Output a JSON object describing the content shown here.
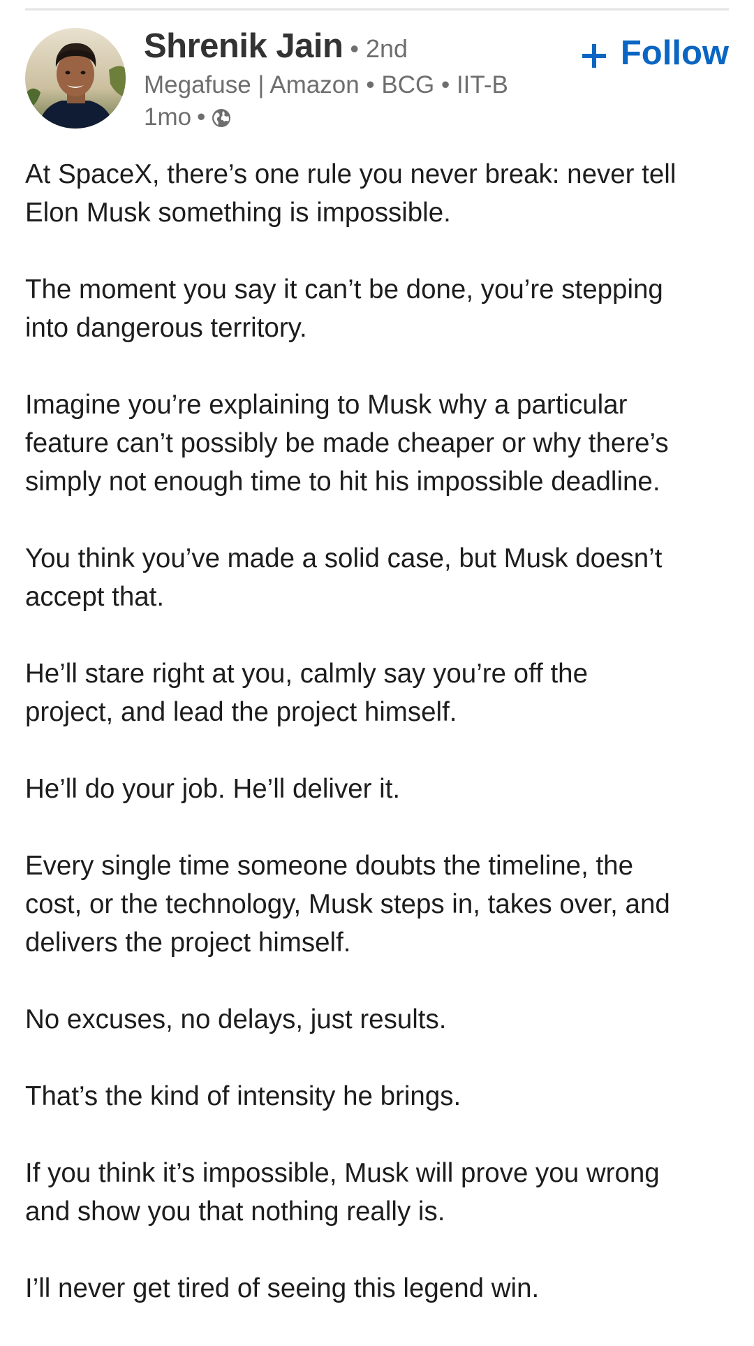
{
  "post": {
    "author": {
      "name": "Shrenik Jain",
      "degree": "• 2nd",
      "headline": "Megafuse | Amazon • BCG • IIT-B",
      "time": "1mo",
      "time_sep": "•",
      "visibility_icon": "globe-icon",
      "avatar_icon": "avatar-photo"
    },
    "follow": {
      "icon": "plus-icon",
      "label": "Follow",
      "color": "#0a66c2"
    },
    "paragraphs": [
      "At SpaceX, there’s one rule you never break: never tell\nElon Musk something is impossible.",
      "The moment you say it can’t be done, you’re stepping\ninto dangerous territory.",
      "Imagine you’re explaining to Musk why a particular\nfeature can’t possibly be made cheaper or why there’s\nsimply not enough time to hit his impossible deadline.",
      "You think you’ve made a solid case, but Musk doesn’t\naccept that.",
      "He’ll stare right at you, calmly say you’re off the\nproject, and lead the project himself.",
      "He’ll do your job. He’ll deliver it.",
      "Every single time someone doubts the timeline, the\ncost, or the technology, Musk steps in, takes over, and\ndelivers the project himself.",
      "No excuses, no delays, just results.",
      "That’s the kind of intensity he brings.",
      "If you think it’s impossible, Musk will prove you wrong\nand show you that nothing really is.",
      "I’ll never get tired of seeing this legend win."
    ]
  }
}
